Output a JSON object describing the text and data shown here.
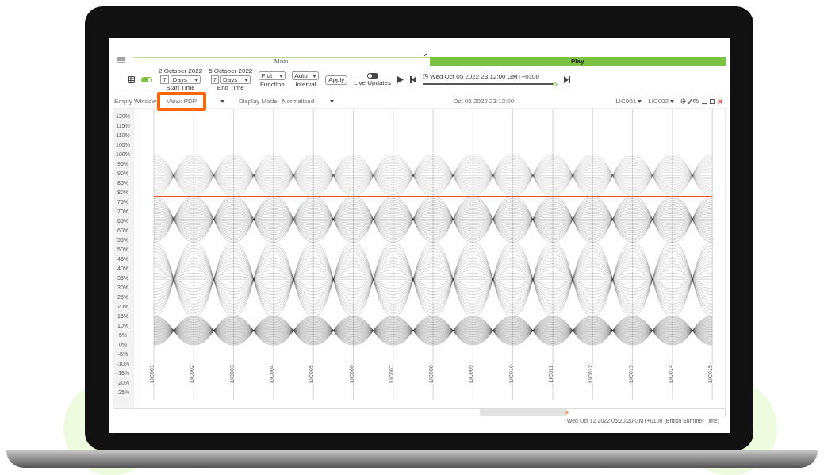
{
  "tabs": [
    {
      "label": "Main",
      "selected": false
    },
    {
      "label": "Play",
      "selected": true
    }
  ],
  "toolbar": {
    "refresh_on": true,
    "start": {
      "date": "2 October 2022",
      "count": "7",
      "unit": "Days",
      "label": "Start Time"
    },
    "end": {
      "date": "5 October 2022",
      "count": "7",
      "unit": "Days",
      "label": "End Time"
    },
    "function": {
      "value": "Plot",
      "label": "Function"
    },
    "interval": {
      "value": "Auto",
      "label": "Interval"
    },
    "apply": "Apply",
    "live_updates": {
      "label": "Live Updates",
      "on": false
    },
    "playback": {
      "time": "Wed Oct 05 2022 23:12:00 GMT+0100",
      "level": 0.98
    }
  },
  "panel": {
    "window": "Empty Window",
    "view": {
      "label": "View: PDP",
      "highlighted": true
    },
    "display_mode_label": "Display Mode:",
    "display_mode": "Normalised",
    "timestamp": "Oct 05 2022 23:12:00",
    "axis_selects": [
      "LIC001",
      "LIC002"
    ]
  },
  "y_ticks": [
    "120%",
    "115%",
    "110%",
    "105%",
    "100%",
    "95%",
    "90%",
    "85%",
    "80%",
    "75%",
    "70%",
    "65%",
    "60%",
    "55%",
    "50%",
    "45%",
    "40%",
    "35%",
    "30%",
    "25%",
    "20%",
    "15%",
    "10%",
    "5%",
    "0%",
    "-5%",
    "-10%",
    "-15%",
    "-20%",
    "-25%"
  ],
  "axes": [
    "LIC001",
    "LIC002",
    "LIC003",
    "LIC004",
    "LIC005",
    "LIC006",
    "LIC007",
    "LIC008",
    "LIC009",
    "LIC010",
    "LIC011",
    "LIC012",
    "LIC013",
    "LIC014",
    "LIC015"
  ],
  "status": "Wed Oct 12 2022 05:20:20 GMT+0100 (British Summer Time)"
}
